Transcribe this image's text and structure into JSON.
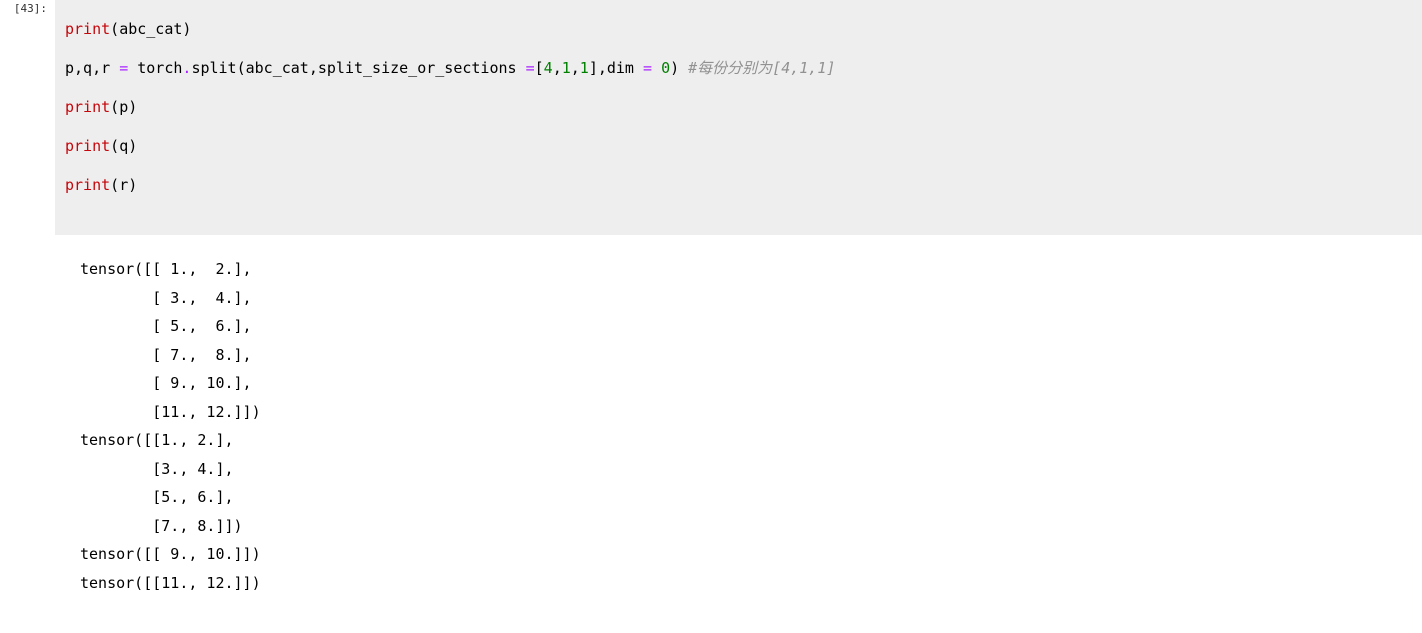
{
  "prompt": "[43]:",
  "code": {
    "line1": {
      "print": "print",
      "open": "(",
      "arg": "abc_cat",
      "close": ")"
    },
    "line2": {
      "lhs": "p,q,r ",
      "eq": "=",
      "sp1": " torch",
      "dot": ".",
      "split": "split",
      "open": "(",
      "arg1": "abc_cat,split_size_or_sections ",
      "eq2": "=",
      "br_open": "[",
      "n4": "4",
      "c1": ",",
      "n1a": "1",
      "c2": ",",
      "n1b": "1",
      "br_close": "]",
      "c3": ",dim ",
      "eq3": "=",
      "sp2": " ",
      "n0": "0",
      "close": ")",
      "sp3": " ",
      "comment": "#每份分别为[4,1,1]"
    },
    "line3": {
      "print": "print",
      "open": "(",
      "arg": "p",
      "close": ")"
    },
    "line4": {
      "print": "print",
      "open": "(",
      "arg": "q",
      "close": ")"
    },
    "line5": {
      "print": "print",
      "open": "(",
      "arg": "r",
      "close": ")"
    }
  },
  "output": "tensor([[ 1.,  2.],\n        [ 3.,  4.],\n        [ 5.,  6.],\n        [ 7.,  8.],\n        [ 9., 10.],\n        [11., 12.]])\ntensor([[1., 2.],\n        [3., 4.],\n        [5., 6.],\n        [7., 8.]])\ntensor([[ 9., 10.]])\ntensor([[11., 12.]])"
}
